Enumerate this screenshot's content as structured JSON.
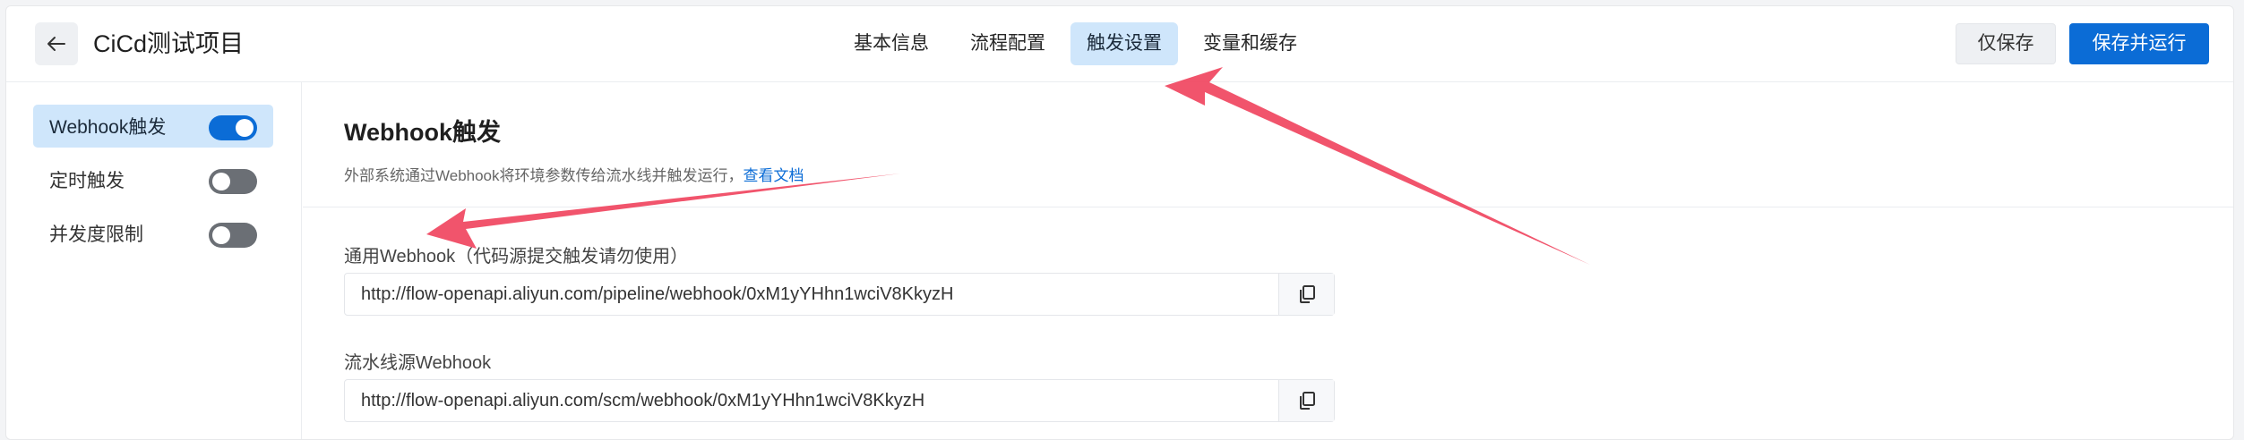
{
  "header": {
    "title": "CiCd测试项目",
    "tabs": [
      {
        "label": "基本信息"
      },
      {
        "label": "流程配置"
      },
      {
        "label": "触发设置"
      },
      {
        "label": "变量和缓存"
      }
    ],
    "active_tab": "触发设置",
    "save_only_label": "仅保存",
    "save_run_label": "保存并运行"
  },
  "sidebar": {
    "items": [
      {
        "label": "Webhook触发",
        "enabled": true,
        "selected": true
      },
      {
        "label": "定时触发",
        "enabled": false,
        "selected": false
      },
      {
        "label": "并发度限制",
        "enabled": false,
        "selected": false
      }
    ]
  },
  "main": {
    "title": "Webhook触发",
    "description": "外部系统通过Webhook将环境参数传给流水线并触发运行，",
    "doc_link": "查看文档",
    "fields": [
      {
        "label": "通用Webhook（代码源提交触发请勿使用）",
        "value": "http://flow-openapi.aliyun.com/pipeline/webhook/0xM1yYHhn1wciV8KkyzH"
      },
      {
        "label": "流水线源Webhook",
        "value": "http://flow-openapi.aliyun.com/scm/webhook/0xM1yYHhn1wciV8KkyzH"
      }
    ]
  },
  "colors": {
    "accent": "#0b6cd6",
    "active_bg": "#cfe6fb",
    "annotation_arrow": "#f0455f"
  },
  "icons": {
    "back": "arrow-left-icon",
    "copy": "copy-icon"
  }
}
